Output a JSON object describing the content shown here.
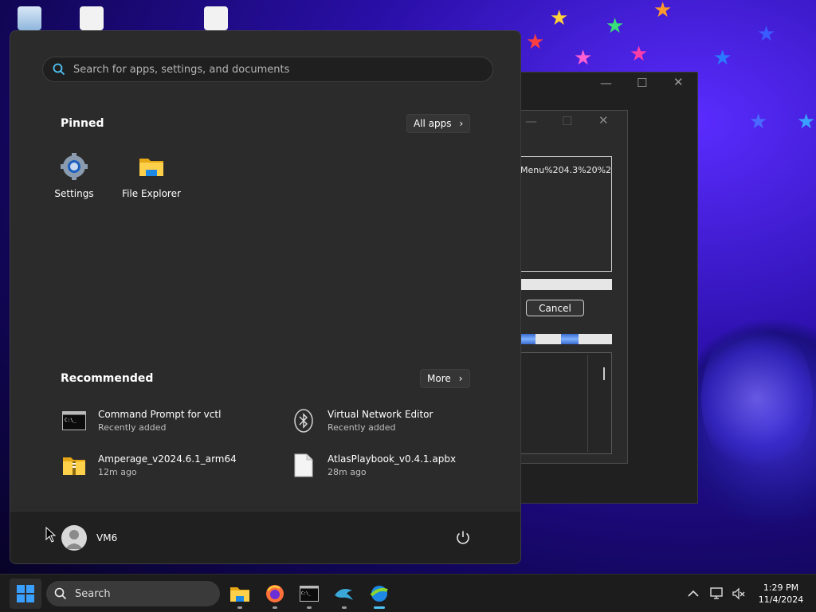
{
  "start_menu": {
    "search_placeholder": "Search for apps, settings, and documents",
    "pinned_title": "Pinned",
    "all_apps_label": "All apps",
    "pinned": [
      {
        "label": "Settings",
        "icon": "gear-icon"
      },
      {
        "label": "File Explorer",
        "icon": "folder-icon"
      }
    ],
    "recommended_title": "Recommended",
    "more_label": "More",
    "recommended": [
      {
        "name": "Command Prompt for vctl",
        "sub": "Recently added",
        "icon": "terminal-icon"
      },
      {
        "name": "Virtual Network Editor",
        "sub": "Recently added",
        "icon": "bluetooth-icon"
      },
      {
        "name": "Amperage_v2024.6.1_arm64",
        "sub": "12m ago",
        "icon": "zip-folder-icon"
      },
      {
        "name": "AtlasPlaybook_v0.4.1.apbx",
        "sub": "28m ago",
        "icon": "file-icon"
      }
    ],
    "user_name": "VM6"
  },
  "bg_window": {
    "text_value": "Menu%204.3%20%2",
    "cancel_label": "Cancel"
  },
  "taskbar": {
    "search_label": "Search",
    "apps": [
      "file-explorer-icon",
      "firefox-icon",
      "terminal-icon",
      "dolphin-icon",
      "installer-icon"
    ],
    "time": "1:29 PM",
    "date": "11/4/2024"
  },
  "colors": {
    "accent": "#0078d4",
    "start_bg": "#2b2b2b",
    "taskbar_bg": "#1c1c1c"
  }
}
